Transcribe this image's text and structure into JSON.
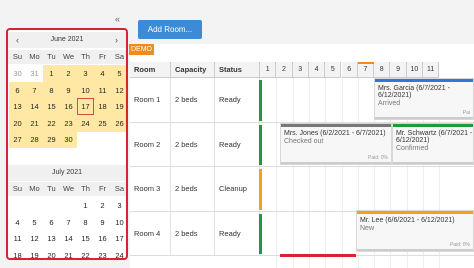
{
  "nav": {
    "collapse_icon": "«",
    "months": [
      {
        "title": "June 2021",
        "prev_icon": "‹",
        "next_icon": "›",
        "dow": [
          "Su",
          "Mo",
          "Tu",
          "We",
          "Th",
          "Fr",
          "Sa"
        ],
        "weeks": [
          [
            "30",
            "31",
            "1",
            "2",
            "3",
            "4",
            "5"
          ],
          [
            "6",
            "7",
            "8",
            "9",
            "10",
            "11",
            "12"
          ],
          [
            "13",
            "14",
            "15",
            "16",
            "17",
            "18",
            "19"
          ],
          [
            "20",
            "21",
            "22",
            "23",
            "24",
            "25",
            "26"
          ],
          [
            "27",
            "28",
            "29",
            "30",
            "",
            "",
            ""
          ]
        ]
      },
      {
        "title": "July 2021",
        "dow": [
          "Su",
          "Mo",
          "Tu",
          "We",
          "Th",
          "Fr",
          "Sa"
        ],
        "weeks": [
          [
            "",
            "",
            "",
            "",
            "1",
            "2",
            "3"
          ],
          [
            "4",
            "5",
            "6",
            "7",
            "8",
            "9",
            "10"
          ],
          [
            "11",
            "12",
            "13",
            "14",
            "15",
            "16",
            "17"
          ],
          [
            "18",
            "19",
            "20",
            "21",
            "22",
            "23",
            "24"
          ]
        ]
      }
    ]
  },
  "toolbar": {
    "add_room_label": "Add Room..."
  },
  "demo_label": "DEMO",
  "grid": {
    "headers": {
      "room": "Room",
      "capacity": "Capacity",
      "status": "Status"
    },
    "days": [
      "1",
      "2",
      "3",
      "4",
      "5",
      "6",
      "7",
      "8",
      "9",
      "10",
      "11"
    ],
    "rooms": [
      {
        "name": "Room 1",
        "capacity": "2 beds",
        "status": "Ready",
        "status_color": "#1a9c3c"
      },
      {
        "name": "Room 2",
        "capacity": "2 beds",
        "status": "Ready",
        "status_color": "#1a9c3c"
      },
      {
        "name": "Room 3",
        "capacity": "2 beds",
        "status": "Cleanup",
        "status_color": "#f0a21f"
      },
      {
        "name": "Room 4",
        "capacity": "2 beds",
        "status": "Ready",
        "status_color": "#1a9c3c"
      }
    ]
  },
  "events": [
    {
      "title": "Mrs. Garcia (6/7/2021 - 6/12/2021)",
      "status": "Arrived",
      "paid": "Pai",
      "color": "#2a7bd8"
    },
    {
      "title": "Mrs. Jones (6/2/2021 - 6/7/2021)",
      "status": "Checked out",
      "paid": "Paid: 0%",
      "color": "#777777"
    },
    {
      "title": "Mr. Schwartz (6/7/2021 - 6/12/2021)",
      "status": "Confirmed",
      "paid": "",
      "color": "#1a9c3c"
    },
    {
      "title": "Mr. Lee (6/6/2021 - 6/12/2021)",
      "status": "New",
      "paid": "Paid: 0%",
      "color": "#f0a21f"
    }
  ]
}
